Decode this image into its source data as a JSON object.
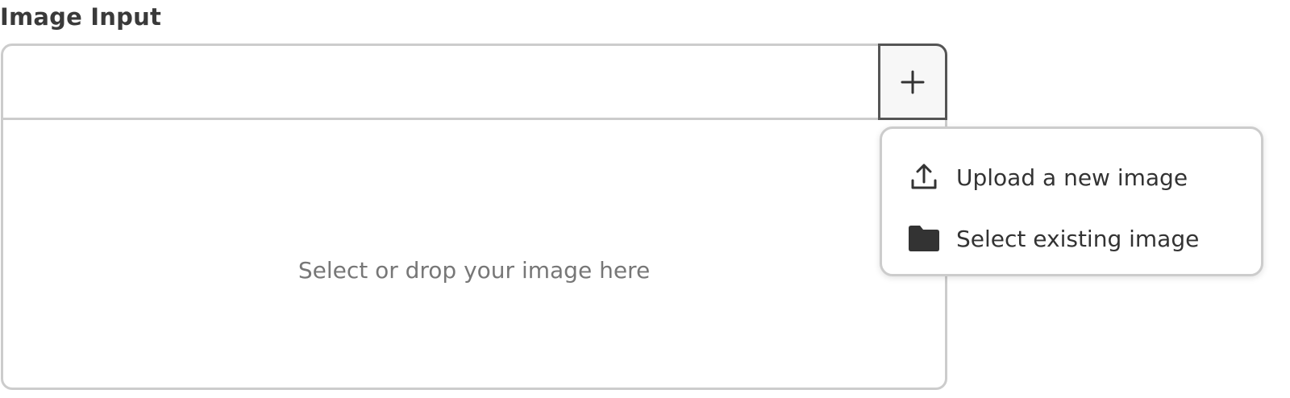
{
  "field": {
    "label": "Image Input"
  },
  "image_input": {
    "drop_placeholder": "Select or drop your image here",
    "add_button_icon": "plus-icon"
  },
  "dropdown": {
    "items": [
      {
        "label": "Upload a new image",
        "icon": "upload-icon"
      },
      {
        "label": "Select existing image",
        "icon": "folder-icon"
      }
    ]
  },
  "colors": {
    "border": "#cccccc",
    "active_border": "#555555",
    "button_bg": "#f7f7f7",
    "placeholder_text": "#777777",
    "text": "#333333"
  }
}
